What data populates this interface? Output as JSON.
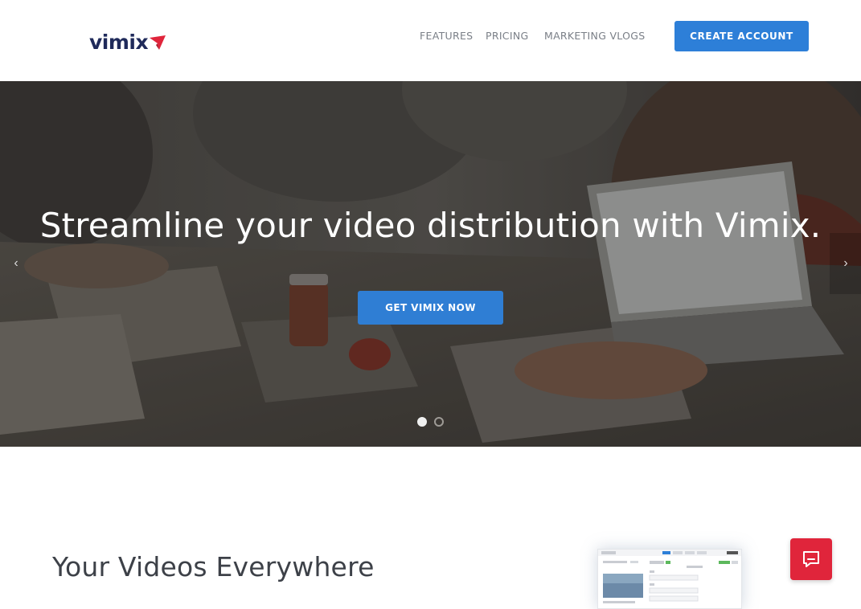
{
  "brand": {
    "name": "vimix",
    "accent": "#2d7fd8",
    "logo_mark_color": "#e0253b"
  },
  "nav": {
    "items": [
      {
        "label": "FEATURES"
      },
      {
        "label": "PRICING"
      },
      {
        "label": "MARKETING VLOGS"
      }
    ],
    "cta_label": "CREATE ACCOUNT"
  },
  "hero": {
    "title": "Streamline your video distribution with Vimix.",
    "button_label": "GET VIMIX NOW",
    "prev_arrow": "‹",
    "next_arrow": "›",
    "slides_count": 2,
    "active_slide": 1
  },
  "section": {
    "title": "Your Videos Everywhere"
  },
  "chat": {
    "icon": "chat-icon",
    "color": "#e0253b"
  }
}
